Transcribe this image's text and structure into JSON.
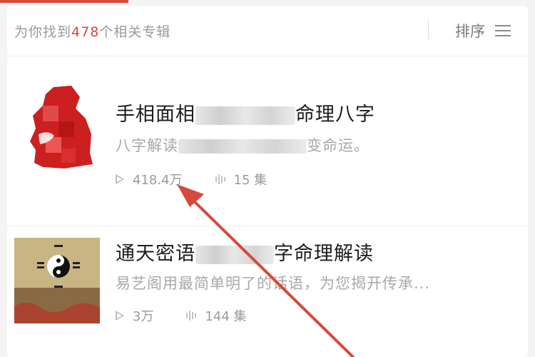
{
  "header": {
    "result_prefix": "为你找到",
    "result_count": "478",
    "result_suffix": "个相关专辑",
    "sort_label": "排序"
  },
  "albums": [
    {
      "title_start": "手相面相",
      "title_end": "命理八字",
      "desc_start": "八字解读",
      "desc_end": "变命运。",
      "plays": "418.4万",
      "episodes": "15 集",
      "cover": "red-cover"
    },
    {
      "title_start": "通天密语",
      "title_end": "字命理解读",
      "desc": "易艺阁用最简单明了的话语，为您揭开传承...",
      "plays": "3万",
      "episodes": "144 集",
      "cover": "taiji-bagua-cover"
    }
  ],
  "colors": {
    "accent": "#d8483c",
    "arrow": "#d8483c"
  }
}
